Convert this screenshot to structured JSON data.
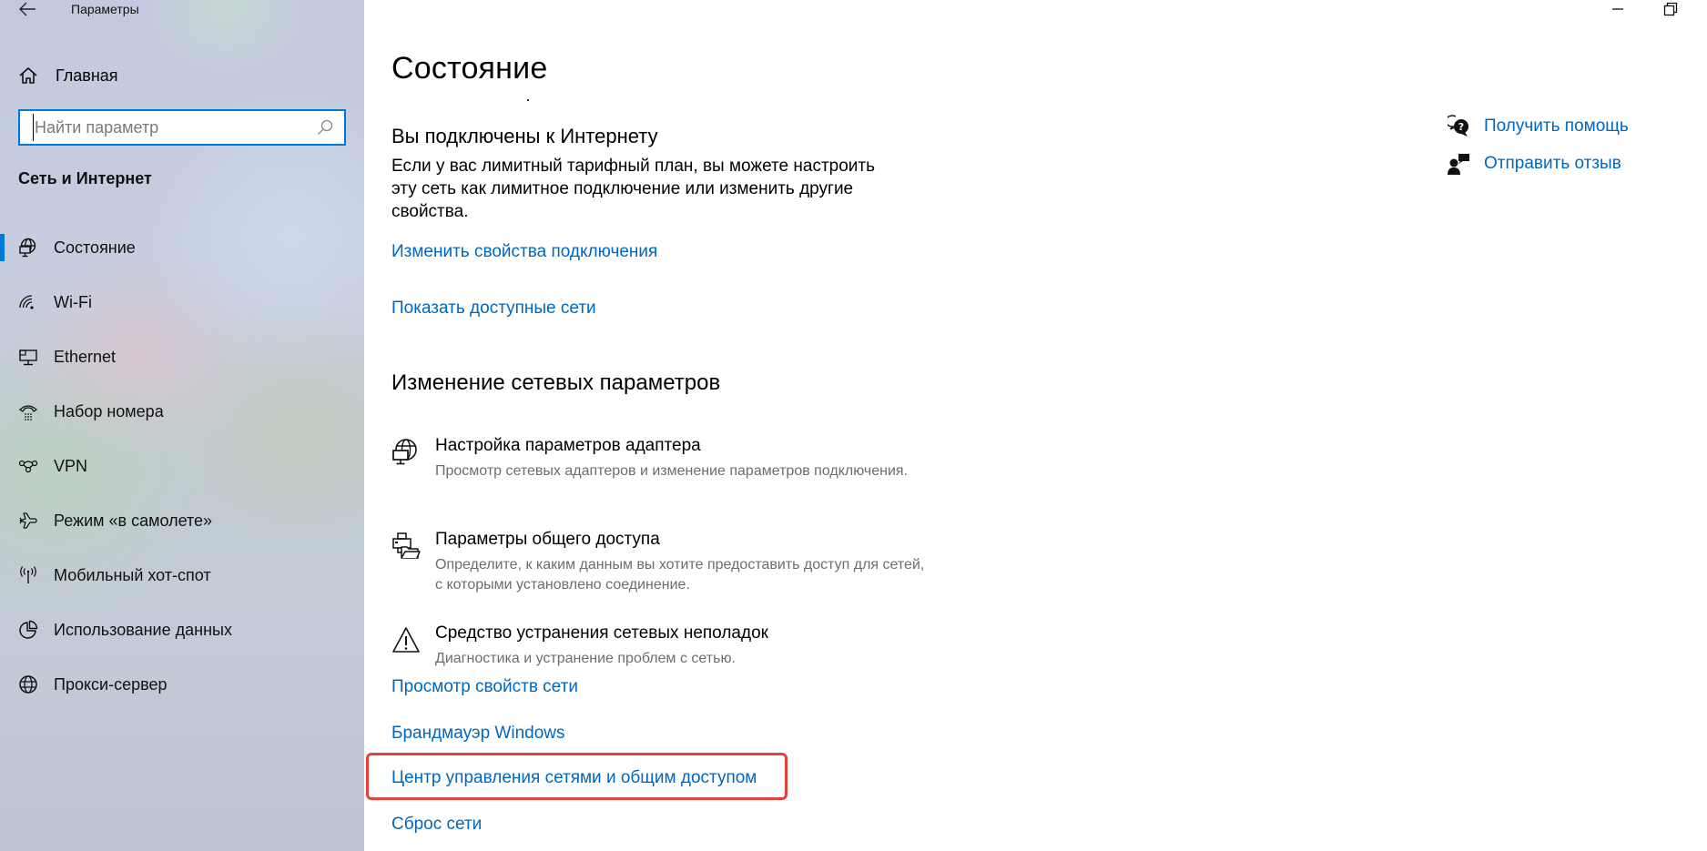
{
  "window": {
    "title": "Параметры",
    "back_icon": "arrow-left-icon",
    "minimize_icon": "minimize-icon",
    "restore_icon": "restore-icon"
  },
  "sidebar": {
    "home": {
      "label": "Главная",
      "icon": "home-icon"
    },
    "search": {
      "placeholder": "Найти параметр",
      "value": "",
      "icon": "search-icon"
    },
    "section_title": "Сеть и Интернет",
    "items": [
      {
        "label": "Состояние",
        "icon": "status-globe-icon",
        "active": true
      },
      {
        "label": "Wi-Fi",
        "icon": "wifi-icon",
        "active": false
      },
      {
        "label": "Ethernet",
        "icon": "ethernet-icon",
        "active": false
      },
      {
        "label": "Набор номера",
        "icon": "dialup-phone-icon",
        "active": false
      },
      {
        "label": "VPN",
        "icon": "vpn-icon",
        "active": false
      },
      {
        "label": "Режим «в самолете»",
        "icon": "airplane-icon",
        "active": false
      },
      {
        "label": "Мобильный хот-спот",
        "icon": "hotspot-icon",
        "active": false
      },
      {
        "label": "Использование данных",
        "icon": "data-usage-icon",
        "active": false
      },
      {
        "label": "Прокси-сервер",
        "icon": "globe-icon",
        "active": false
      }
    ],
    "accent_color": "#0078d7"
  },
  "main": {
    "page_title": "Состояние",
    "connection": {
      "heading": "Вы подключены к Интернету",
      "description": "Если у вас лимитный тарифный план, вы можете настроить эту сеть как лимитное подключение или изменить другие свойства.",
      "links": [
        "Изменить свойства подключения",
        "Показать доступные сети"
      ]
    },
    "change_section": {
      "heading": "Изменение сетевых параметров",
      "settings": [
        {
          "title": "Настройка параметров адаптера",
          "description": "Просмотр сетевых адаптеров и изменение параметров подключения.",
          "icon": "adapter-globe-icon"
        },
        {
          "title": "Параметры общего доступа",
          "description": "Определите, к каким данным вы хотите предоставить доступ для сетей, с которыми установлено соединение.",
          "icon": "sharing-printer-folder-icon"
        },
        {
          "title": "Средство устранения сетевых неполадок",
          "description": "Диагностика и устранение проблем с сетью.",
          "icon": "warning-icon"
        }
      ],
      "links": [
        "Просмотр свойств сети",
        "Брандмауэр Windows",
        "Центр управления сетями и общим доступом",
        "Сброс сети"
      ],
      "highlighted_link": "Центр управления сетями и общим доступом"
    },
    "side_links": [
      {
        "label": "Получить помощь",
        "icon": "help-chat-icon"
      },
      {
        "label": "Отправить отзыв",
        "icon": "feedback-icon"
      }
    ],
    "link_color": "#0067c0",
    "highlight_color": "#e5413a"
  }
}
